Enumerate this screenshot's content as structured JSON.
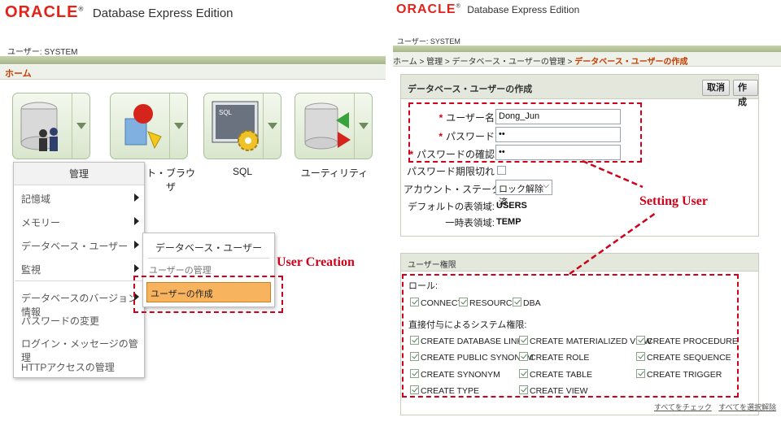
{
  "left": {
    "logo": {
      "brand": "ORACLE",
      "reg": "®",
      "product": "Database Express Edition"
    },
    "user_line": "ユーザー: SYSTEM",
    "home_link": "ホーム",
    "tiles": [
      {
        "label": "管理"
      },
      {
        "label": "ト・ブラウザ"
      },
      {
        "label": "SQL"
      },
      {
        "label": "ユーティリティ"
      }
    ],
    "menu": {
      "header": "管理",
      "items": [
        {
          "label": "記憶域",
          "submenu": true
        },
        {
          "label": "メモリー",
          "submenu": true
        },
        {
          "label": "データベース・ユーザー",
          "submenu": true
        },
        {
          "label": "監視",
          "submenu": true
        },
        {
          "label": "データベースのバージョン情報",
          "submenu": true
        },
        {
          "label": "パスワードの変更",
          "submenu": false
        },
        {
          "label": "ログイン・メッセージの管理",
          "submenu": false
        },
        {
          "label": "HTTPアクセスの管理",
          "submenu": false
        }
      ]
    },
    "submenu": {
      "header": "データベース・ユーザー",
      "items": [
        "ユーザーの管理",
        "ユーザーの作成"
      ],
      "selected": "ユーザーの作成"
    },
    "annotation": "User Creation"
  },
  "right": {
    "logo": {
      "brand": "ORACLE",
      "reg": "®",
      "product": "Database Express Edition"
    },
    "user_line": "ユーザー: SYSTEM",
    "breadcrumb": {
      "items": [
        "ホーム",
        "管理",
        "データベース・ユーザーの管理"
      ],
      "separator": ">",
      "current": "データベース・ユーザーの作成"
    },
    "form": {
      "title": "データベース・ユーザーの作成",
      "cancel_label": "取消",
      "create_label": "作成",
      "username_label": "ユーザー名",
      "username_value": "Dong_Jun",
      "password_label": "パスワード",
      "password_value": "••",
      "confirm_label": "パスワードの確認",
      "confirm_value": "••",
      "expire_label": "パスワード期限切れ",
      "expire_checked": false,
      "status_label": "アカウント・ステータス",
      "status_value": "ロック解除済",
      "tablespace_label": "デフォルトの表領域:",
      "tablespace_value": "USERS",
      "temp_label": "一時表領域:",
      "temp_value": "TEMP"
    },
    "annotation": "Setting User",
    "privileges": {
      "title": "ユーザー権限",
      "roles_label": "ロール:",
      "roles": [
        "CONNECT",
        "RESOURCE",
        "DBA"
      ],
      "sys_label": "直接付与によるシステム権限:",
      "sys_privs": [
        "CREATE DATABASE LINK",
        "CREATE MATERIALIZED VIEW",
        "CREATE PROCEDURE",
        "CREATE PUBLIC SYNONYM",
        "CREATE ROLE",
        "CREATE SEQUENCE",
        "CREATE SYNONYM",
        "CREATE TABLE",
        "CREATE TRIGGER",
        "CREATE TYPE",
        "CREATE VIEW"
      ],
      "check_all": "すべてをチェック",
      "uncheck_all": "すべてを選択解除"
    }
  },
  "colors": {
    "oracle_red": "#e2231a",
    "annotation_red": "#d0021b",
    "highlight_orange": "#f7b35d",
    "breadcrumb_current": "#c63d00"
  }
}
